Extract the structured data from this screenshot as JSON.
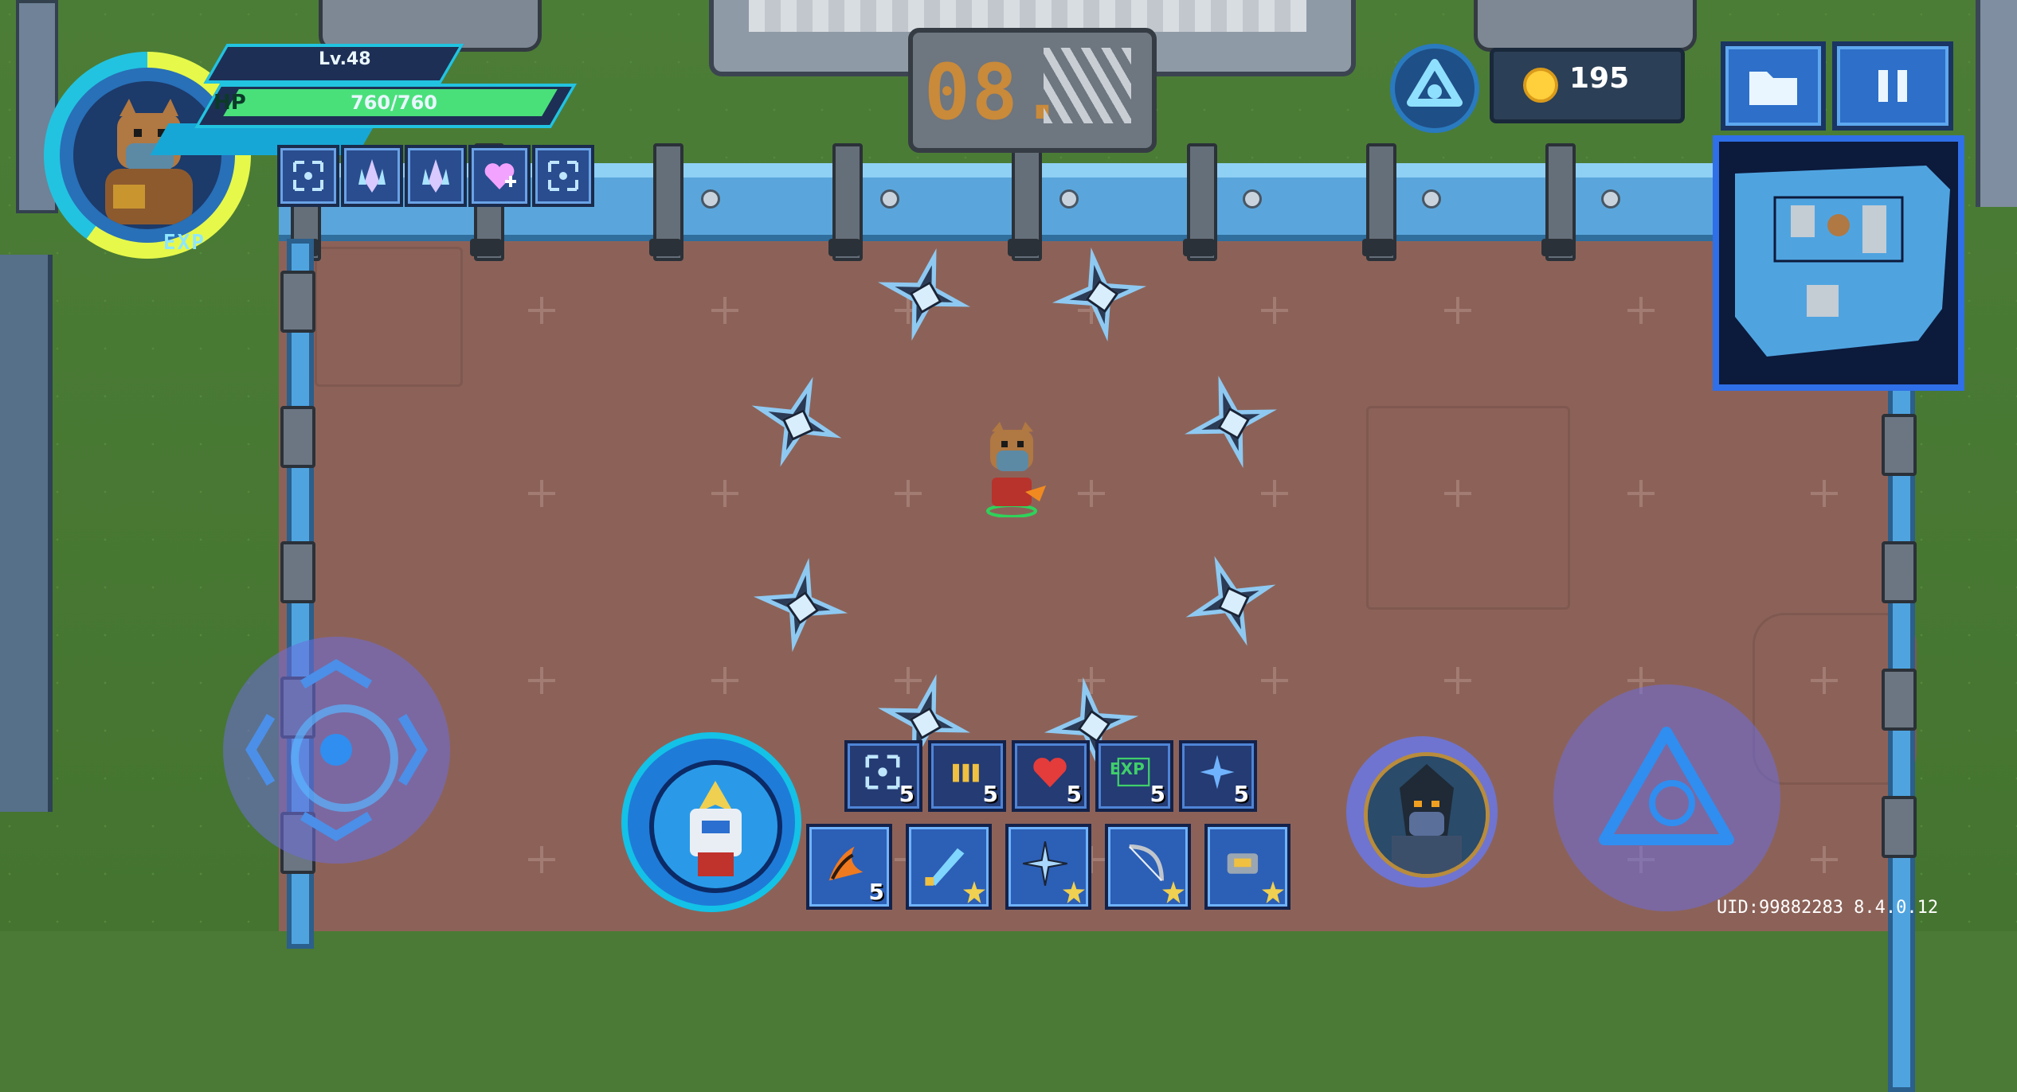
{
  "player": {
    "level": "Lv.48",
    "hp_label": "HP",
    "hp_value": "760/760",
    "exp_label": "EXP"
  },
  "stage": {
    "number": "08."
  },
  "currency": {
    "coins": "195"
  },
  "skill_icons": [
    "expand-icon",
    "crystal-icon",
    "crystal-icon",
    "heart-plus-icon",
    "expand-icon"
  ],
  "passives": [
    {
      "icon": "expand-icon",
      "count": "5"
    },
    {
      "icon": "ammo-icon",
      "count": "5"
    },
    {
      "icon": "heart-icon",
      "count": "5"
    },
    {
      "icon": "exp-icon",
      "count": "5",
      "text": "EXP"
    },
    {
      "icon": "sparkle-icon",
      "count": "5"
    }
  ],
  "weapons": [
    {
      "icon": "fire-claw-icon",
      "count": "5"
    },
    {
      "icon": "energy-blade-icon"
    },
    {
      "icon": "shuriken-icon"
    },
    {
      "icon": "bow-icon"
    },
    {
      "icon": "gauntlet-icon"
    }
  ],
  "footer": {
    "uid": "UID:99882283 8.4.0.12"
  },
  "colors": {
    "accent_cyan": "#22c3e0",
    "hp_green": "#49e07a",
    "coin_gold": "#ffcf3c",
    "arena_floor": "#8c6258"
  }
}
